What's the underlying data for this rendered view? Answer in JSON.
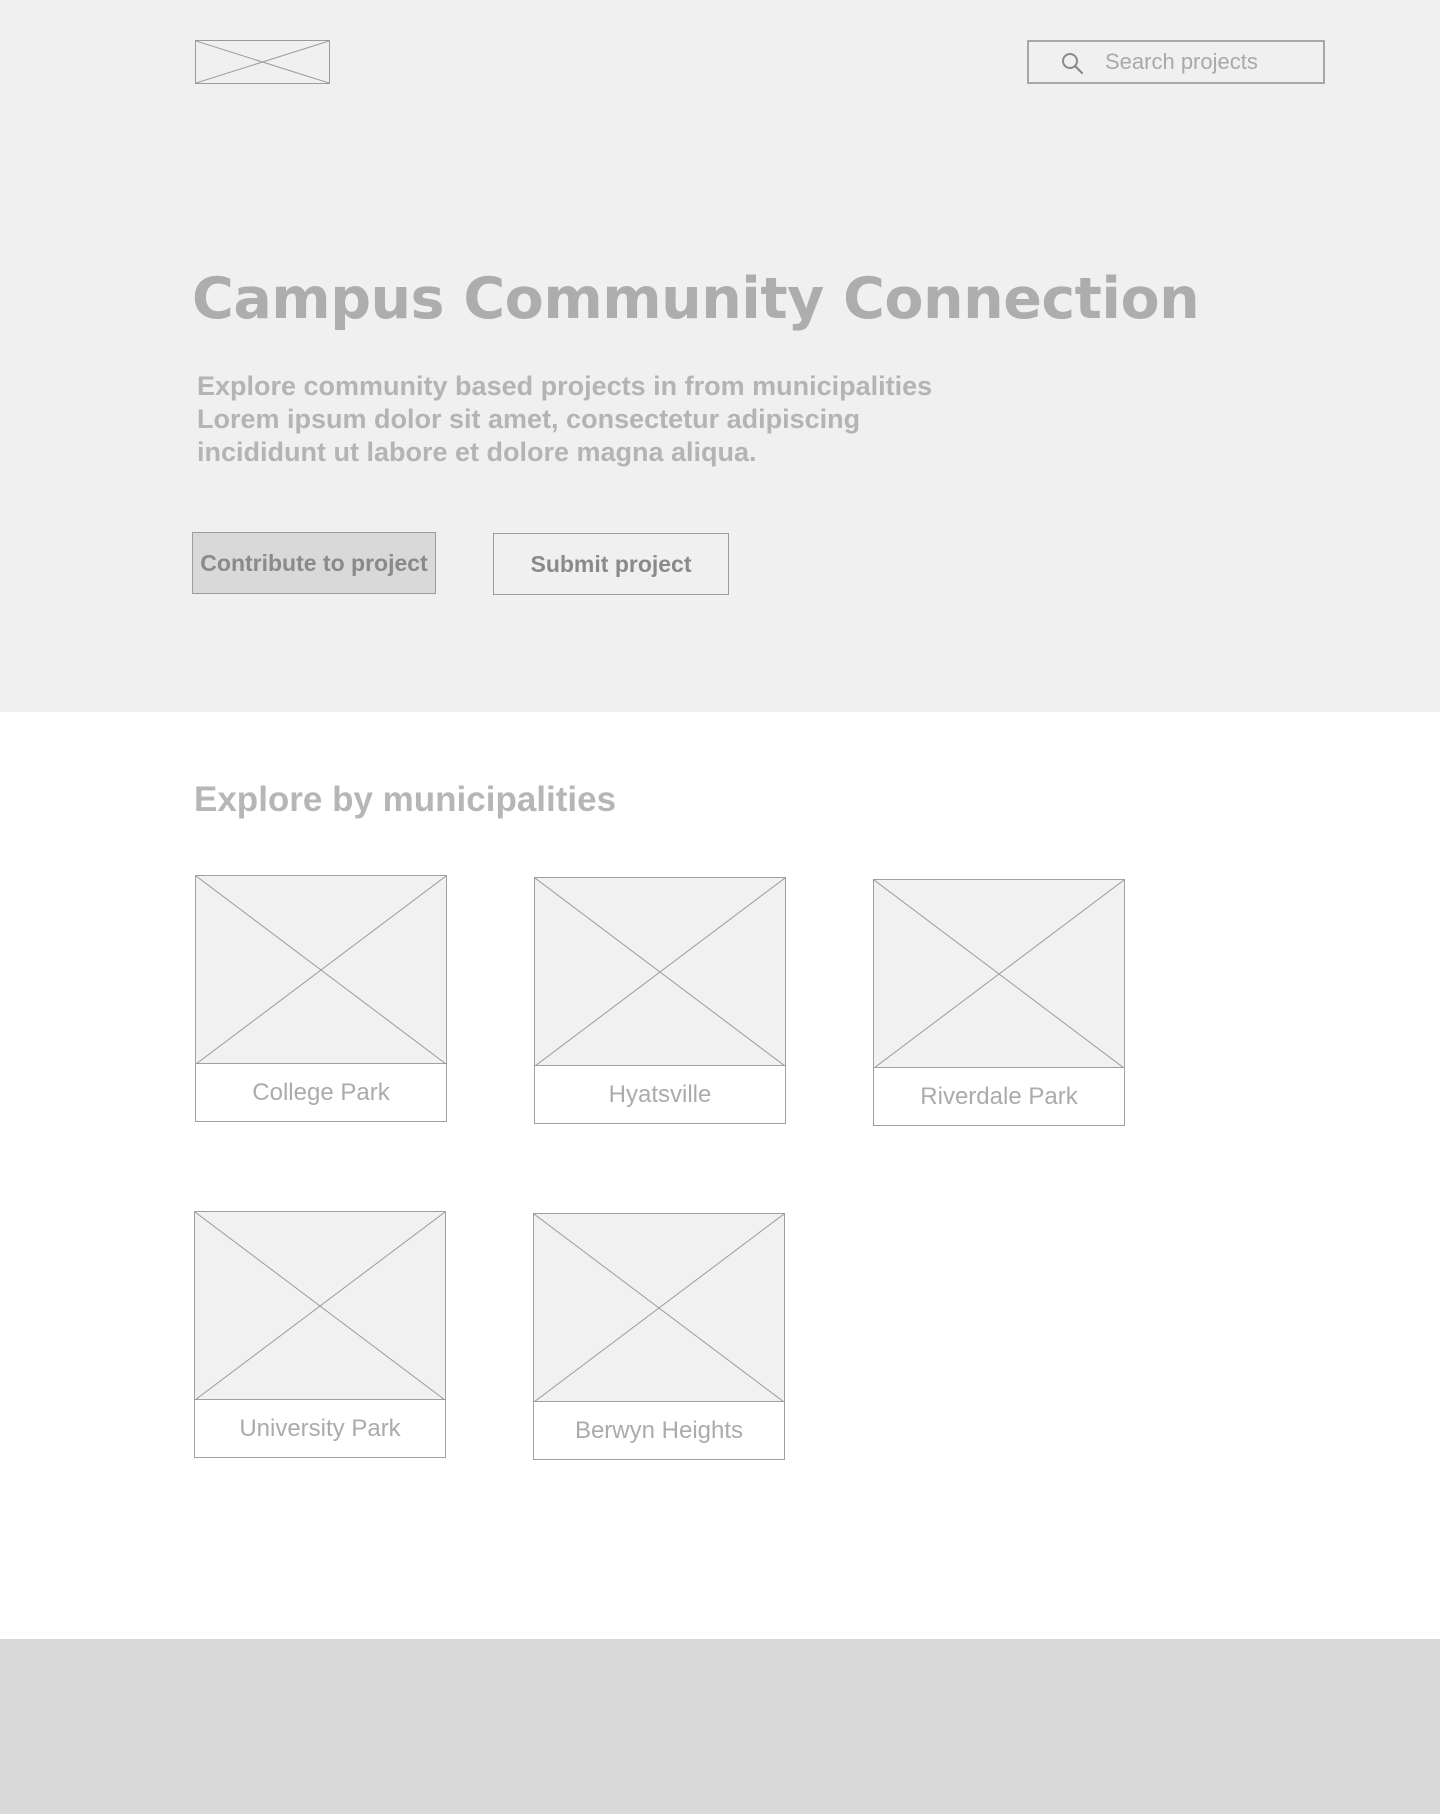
{
  "header": {
    "logo": "logo-placeholder",
    "search": {
      "placeholder": "Search projects",
      "value": "",
      "icon": "search-icon"
    }
  },
  "hero": {
    "title": "Campus Community Connection",
    "description_lines": [
      "Explore community based projects in from municipalities",
      "Lorem ipsum dolor sit amet, consectetur adipiscing",
      "incididunt ut labore et dolore magna aliqua."
    ],
    "buttons": {
      "contribute_label": "Contribute to project",
      "submit_label": "Submit project"
    }
  },
  "municipalities": {
    "title": "Explore by municipalities",
    "items": [
      {
        "name": "College Park",
        "image": "image-placeholder"
      },
      {
        "name": "Hyatsville",
        "image": "image-placeholder"
      },
      {
        "name": "Riverdale Park",
        "image": "image-placeholder"
      },
      {
        "name": "University Park",
        "image": "image-placeholder"
      },
      {
        "name": "Berwyn Heights",
        "image": "image-placeholder"
      }
    ]
  },
  "colors": {
    "hero_background": "#f0f0f0",
    "footer_background": "#d9d9d9",
    "title_text": "#aeacac",
    "button_primary_background": "#d9d9d9",
    "border": "#a0a0a0"
  }
}
